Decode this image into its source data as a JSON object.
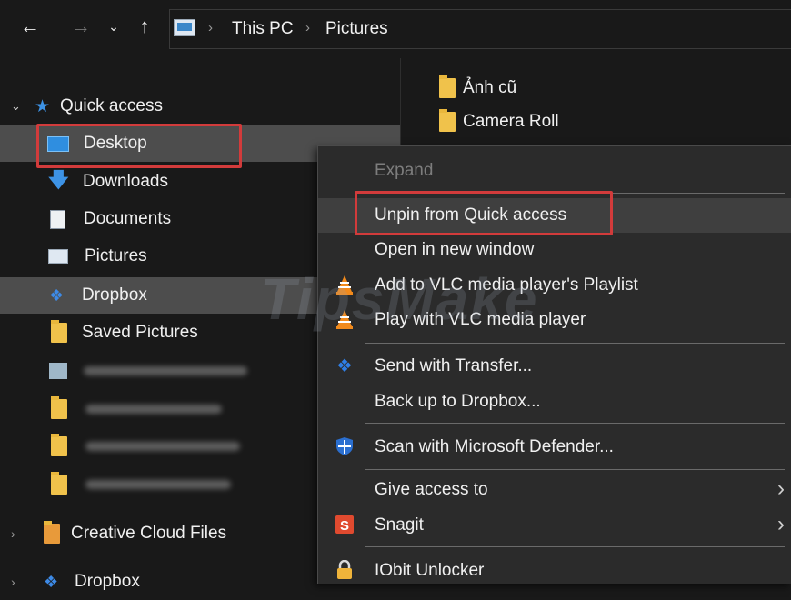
{
  "window": {
    "breadcrumb": [
      "This PC",
      "Pictures"
    ]
  },
  "nav_pane": {
    "quick_access": "Quick access",
    "items": [
      "Desktop",
      "Downloads",
      "Documents",
      "Pictures",
      "Dropbox",
      "Saved Pictures"
    ],
    "bottom_items": [
      "Creative Cloud Files",
      "Dropbox"
    ]
  },
  "files": [
    "Ảnh cũ",
    "Camera Roll"
  ],
  "context_menu": {
    "items": [
      {
        "label": "Expand",
        "enabled": false
      },
      {
        "label": "Unpin from Quick access",
        "enabled": true
      },
      {
        "label": "Open in new window",
        "enabled": true
      },
      {
        "label": "Add to VLC media player's Playlist",
        "enabled": true
      },
      {
        "label": "Play with VLC media player",
        "enabled": true
      },
      {
        "label": "Send with Transfer...",
        "enabled": true
      },
      {
        "label": "Back up to Dropbox...",
        "enabled": true
      },
      {
        "label": "Scan with Microsoft Defender...",
        "enabled": true
      },
      {
        "label": "Give access to",
        "enabled": true,
        "submenu": true
      },
      {
        "label": "Snagit",
        "enabled": true,
        "submenu": true
      },
      {
        "label": "IObit Unlocker",
        "enabled": true
      }
    ]
  },
  "highlight_color": "#d23b3b",
  "watermark": "TipsMake"
}
